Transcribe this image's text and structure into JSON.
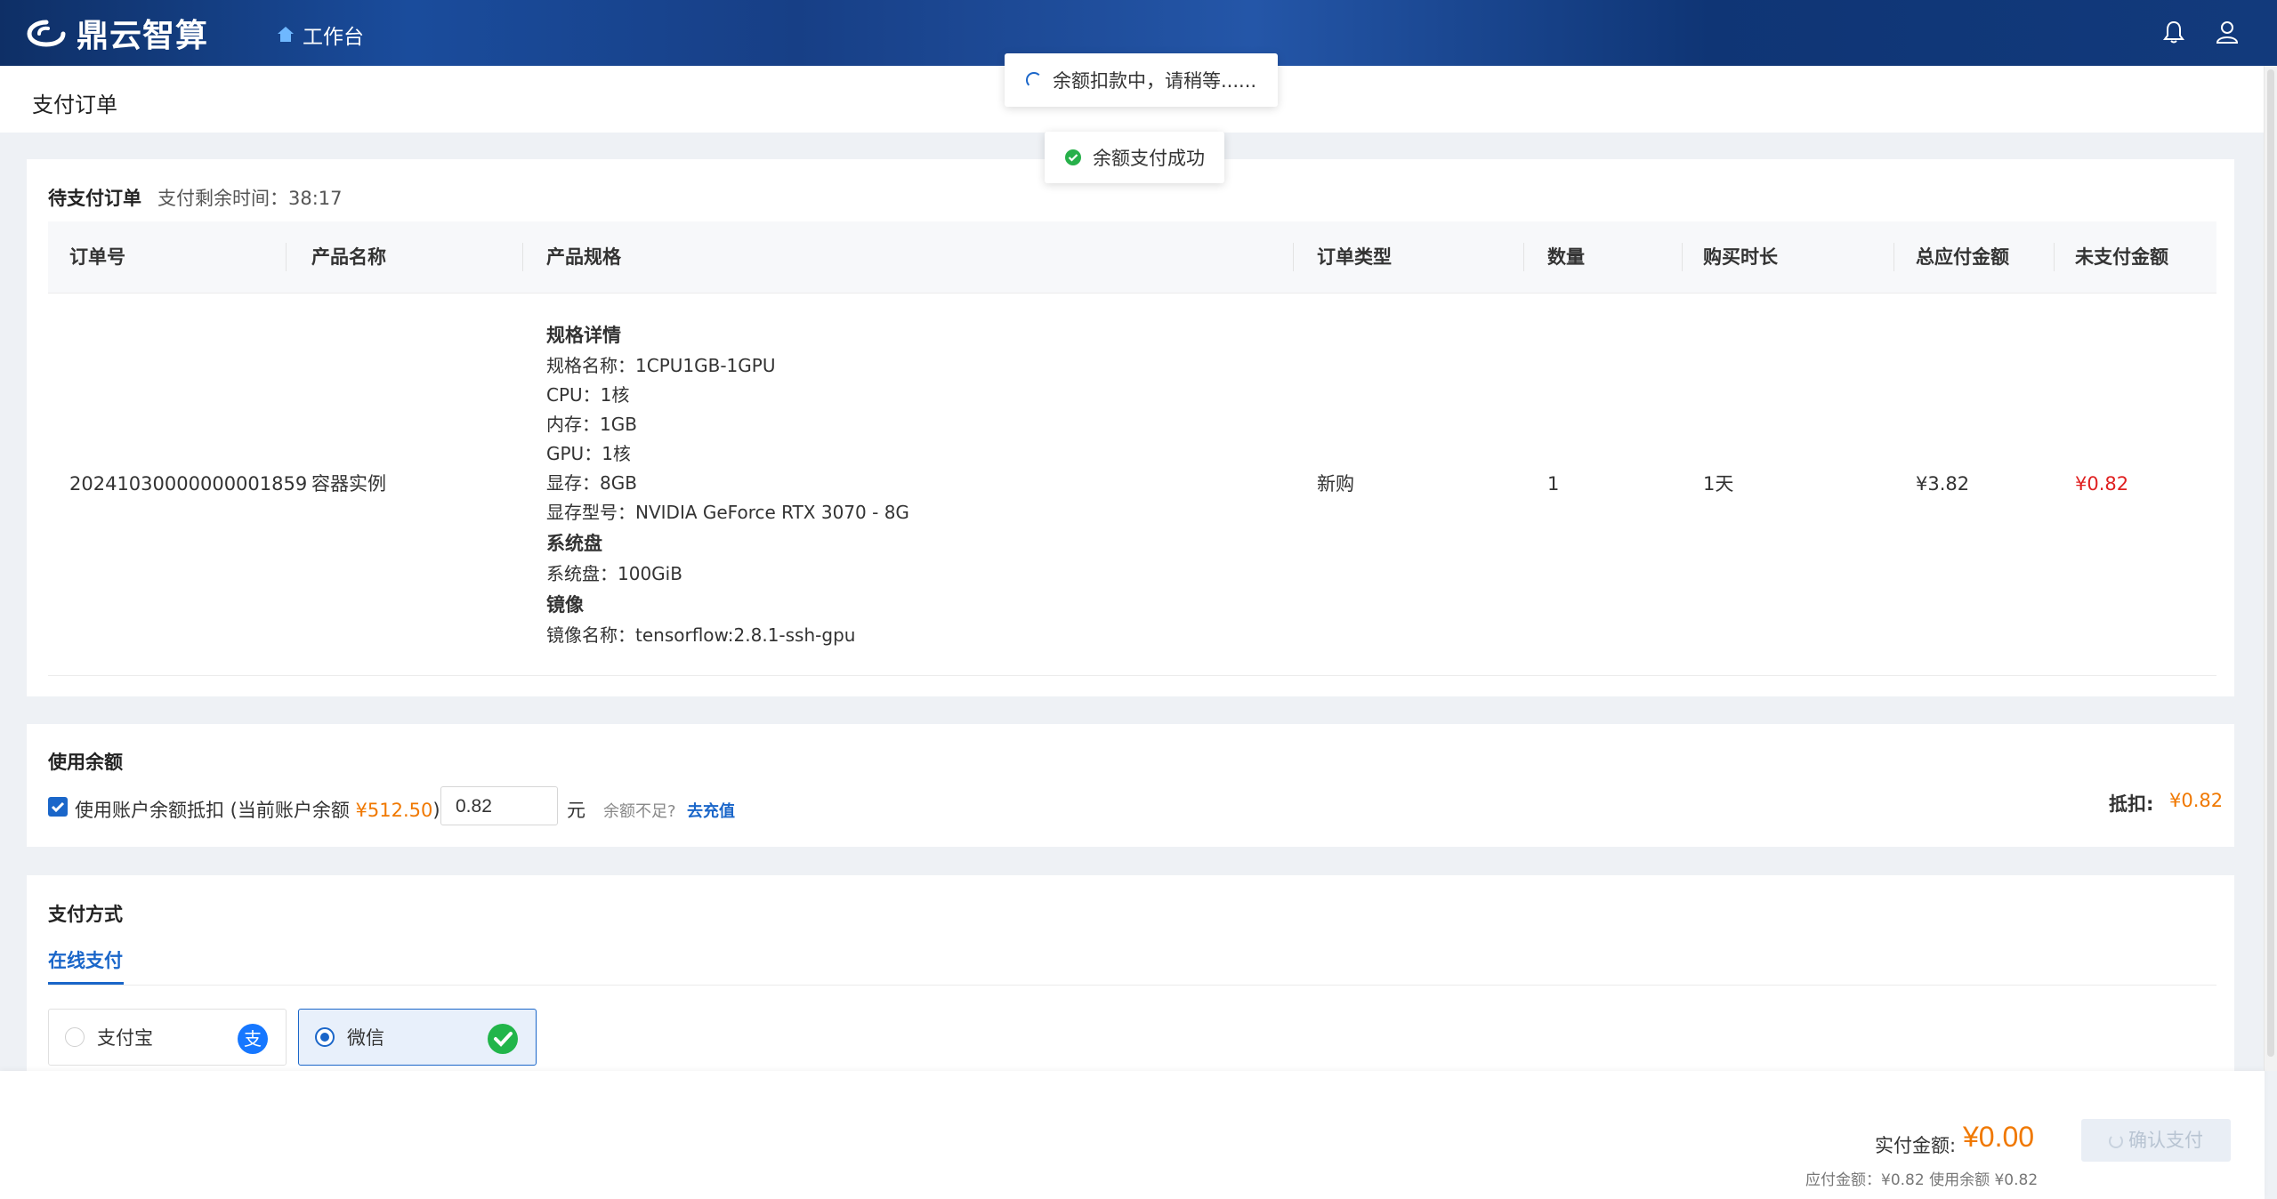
{
  "header": {
    "brand": "鼎云智算",
    "workbench": "工作台",
    "icons": [
      "bell-icon",
      "user-icon"
    ]
  },
  "page": {
    "title": "支付订单"
  },
  "toasts": {
    "processing": "余额扣款中，请稍等......",
    "success": "余额支付成功"
  },
  "order": {
    "section_label": "待支付订单",
    "remaining_label": "支付剩余时间：",
    "remaining_time": "38:17",
    "columns": [
      "订单号",
      "产品名称",
      "产品规格",
      "订单类型",
      "数量",
      "购买时长",
      "总应付金额",
      "未支付金额"
    ],
    "row": {
      "order_no": "20241030000000001859",
      "product_name": "容器实例",
      "spec": {
        "spec_title": "规格详情",
        "spec_name": "规格名称：1CPU1GB-1GPU",
        "cpu": "CPU：1核",
        "memory": "内存：1GB",
        "gpu": "GPU：1核",
        "vram": "显存：8GB",
        "vram_model": "显存型号：NVIDIA GeForce RTX 3070 - 8G",
        "disk_title": "系统盘",
        "disk": "系统盘：100GiB",
        "image_title": "镜像",
        "image": "镜像名称：tensorflow:2.8.1-ssh-gpu"
      },
      "order_type": "新购",
      "quantity": "1",
      "duration": "1天",
      "total": "¥3.82",
      "unpaid": "¥0.82"
    }
  },
  "balance": {
    "section_label": "使用余额",
    "checkbox_label": "使用账户余额抵扣 (当前账户余额 ",
    "balance_value": "¥512.50",
    "checkbox_close": ")",
    "checked": true,
    "amount": "0.82",
    "unit": "元",
    "insufficient": "余额不足?",
    "recharge": "去充值",
    "deduct_label": "抵扣:",
    "deduct_value": "¥0.82"
  },
  "payment": {
    "section_label": "支付方式",
    "tab": "在线支付",
    "methods": [
      {
        "label": "支付宝",
        "selected": false,
        "icon": "alipay-icon",
        "color": "#1677ff"
      },
      {
        "label": "微信",
        "selected": true,
        "icon": "wechat-icon",
        "color": "#21b54a"
      }
    ]
  },
  "footer": {
    "actual_label": "实付金额:",
    "actual_value": "¥0.00",
    "detail": "应付金额：¥0.82 使用余额 ¥0.82",
    "confirm": "确认支付"
  },
  "colors": {
    "primary": "#1a66c9",
    "orange": "#f07800",
    "red": "#e02020"
  }
}
